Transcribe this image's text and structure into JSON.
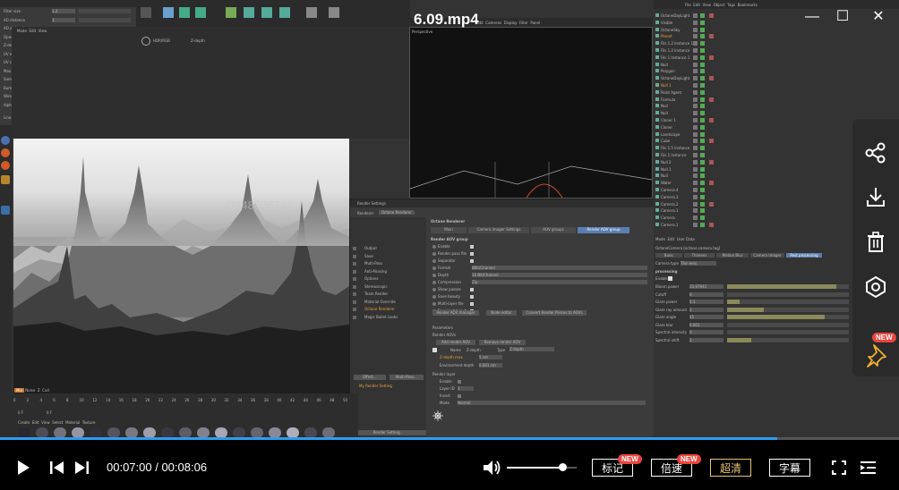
{
  "video": {
    "title": "6.09.mp4",
    "current_time": "00:07:00",
    "total_time": "00:08:06",
    "time_separator": " / ",
    "progress": 0.865,
    "volume": 0.8,
    "watermark": "Q348606741"
  },
  "window_controls": {
    "minimize": "—",
    "maximize": "☐",
    "close": "✕"
  },
  "controls": {
    "notes_label": "标记",
    "notes_badge": "NEW",
    "speed_label": "倍速",
    "speed_badge": "NEW",
    "quality_label": "超清",
    "subtitle_label": "字幕"
  },
  "side_panel": {
    "new_badge": "NEW",
    "buttons": [
      "share-icon",
      "download-icon",
      "delete-icon",
      "screen-icon",
      "pin-icon"
    ]
  },
  "colors": {
    "progress": "#2d9df0",
    "badge": "#e8453c",
    "quality": "#e8c373",
    "selected_tab": "#5a7fb0",
    "orange_text": "#e8a040"
  },
  "c4d": {
    "left_params": [
      {
        "label": "Filter size",
        "value": "1.2"
      },
      {
        "label": "AO distance",
        "value": "3"
      },
      {
        "label": "AO alpha shadows",
        "value": ""
      },
      {
        "label": "Opacity threshold",
        "value": "1"
      },
      {
        "label": "Z-depth max",
        "value": "0.1651 M"
      },
      {
        "label": "UV max",
        "value": "1"
      },
      {
        "label": "UV coord. selection",
        "value": "1"
      },
      {
        "label": "Max speed",
        "value": "1"
      },
      {
        "label": "Sampling mode",
        "value": "Distributed rays"
      },
      {
        "label": "Bump and normal mapping",
        "value": ""
      },
      {
        "label": "Wireframe backface highlighting",
        "value": ""
      },
      {
        "label": "Alpha channel",
        "value": ""
      }
    ],
    "layer_label": "Line 1, Pos. 1",
    "viewport_label": "Perspective",
    "view_menu": [
      "Edit",
      "Cameras",
      "Display",
      "Filter",
      "Panel"
    ],
    "render_view_tabs": [
      "Mode",
      "Edit",
      "View"
    ],
    "channel_menu": [
      "HDR/RGB",
      "Z-depth"
    ],
    "bottom_tabs": [
      "Mix",
      "Noise",
      "Z",
      "Cull"
    ],
    "timeline_ticks": [
      "0",
      "2",
      "4",
      "6",
      "8",
      "10",
      "12",
      "14",
      "16",
      "18",
      "20",
      "22",
      "24",
      "26",
      "28",
      "30",
      "32",
      "34",
      "36",
      "38",
      "40",
      "42",
      "44",
      "46",
      "48",
      "50"
    ],
    "frame_start": "0 F",
    "frame_current": "0 F",
    "material_menu": [
      "Create",
      "Edit",
      "View",
      "Select",
      "Material",
      "Texture"
    ]
  },
  "render_settings": {
    "title": "Render Settings",
    "renderer_label": "Renderer",
    "renderer_value": "Octane Renderer",
    "left_items": [
      "Output",
      "Save",
      "Multi-Pass",
      "Anti-Aliasing",
      "Options",
      "Stereoscopic",
      "Team Render",
      "Material Override",
      "Octane Renderer",
      "Magic Bullet Looks"
    ],
    "effect_button": "Effect...",
    "multipass_button": "Multi-Pass...",
    "my_setting": "My Render Setting",
    "bottom_button": "Render Setting...",
    "section_title": "Octane Renderer",
    "tabs": [
      "Main",
      "Camera Imager Settings",
      "AOV groups",
      "Render AOV group"
    ],
    "group_title": "Render AOV group",
    "params": [
      {
        "label": "Enable",
        "value": ""
      },
      {
        "label": "Render pass file",
        "value": ""
      },
      {
        "label": "Separator",
        "value": ""
      },
      {
        "label": "Format",
        "value": "8Bit/Channel"
      },
      {
        "label": "Depth",
        "value": "16 Bit/Channel"
      },
      {
        "label": "Compression",
        "value": "Zip"
      },
      {
        "label": "Show passes",
        "value": ""
      },
      {
        "label": "Save beauty",
        "value": ""
      },
      {
        "label": "Multi-layer file",
        "value": ""
      },
      {
        "label": "Denoised beauty",
        "value": ""
      }
    ],
    "aov_buttons": [
      "Render AOV manager",
      "Node editor",
      "Convert Render Passes to AOVs"
    ],
    "parameters_label": "Parameters",
    "render_aovs_label": "Render AOVs",
    "add_aov": "Add render AOV",
    "remove_aov": "Remove render AOV",
    "aov_name_label": "Name",
    "aov_name": "Z-depth",
    "aov_type_label": "Type",
    "aov_type": "Z-depth",
    "zdepth_max_label": "Z-depth max",
    "zdepth_max": "5 cm",
    "env_depth_label": "Environment depth",
    "env_depth": "0.001 cm",
    "render_layer_label": "Render layer",
    "layer_params": [
      {
        "label": "Enable",
        "value": ""
      },
      {
        "label": "Layer ID",
        "value": "1"
      },
      {
        "label": "Invert",
        "value": ""
      },
      {
        "label": "Mode",
        "value": "Normal"
      }
    ]
  },
  "object_manager": {
    "menu": [
      "File",
      "Edit",
      "View",
      "Object",
      "Tags",
      "Bookmarks"
    ],
    "objects": [
      "OctaneDayLight",
      "Visible",
      "OctaneSky",
      "Planet",
      "Fils 1.2 Instance 1",
      "Fils 1.2 Instance",
      "Fils 1 Instance 1",
      "Null",
      "Polygon",
      "OctaneDayLight",
      "Null 1",
      "Point Agent",
      "Formula",
      "Null",
      "Null",
      "Cloner 1",
      "Cloner",
      "Landscape",
      "Cube",
      "Fils 1.5 Instance",
      "Fils 1 Instance",
      "Null 2",
      "Null 1",
      "Null",
      "Water",
      "Camera.4",
      "Camera.3",
      "Camera.2",
      "Camera.1",
      "Camera",
      "Camera.1"
    ],
    "attr_menu": [
      "Mode",
      "Edit",
      "User Data"
    ],
    "attr_title": "OctaneCamera [octane.camera.tag]",
    "attr_tabs": [
      "Basic",
      "Thinlens",
      "Motion Blur",
      "Camera Imager",
      "Post processing"
    ],
    "camera_type_label": "Camera type",
    "camera_type": "Thin lens",
    "post_label": "processing",
    "post_enable": "Enable",
    "post_params": [
      {
        "label": "Bloom power",
        "value": "33.97943"
      },
      {
        "label": "Cutoff",
        "value": "0"
      },
      {
        "label": "Glare power",
        "value": "0.1"
      },
      {
        "label": "Glare ray amount",
        "value": "3"
      },
      {
        "label": "Glare angle",
        "value": "15"
      },
      {
        "label": "Glare blur",
        "value": "0.001"
      },
      {
        "label": "Spectral intensity",
        "value": "0"
      },
      {
        "label": "Spectral shift",
        "value": "2"
      }
    ]
  }
}
